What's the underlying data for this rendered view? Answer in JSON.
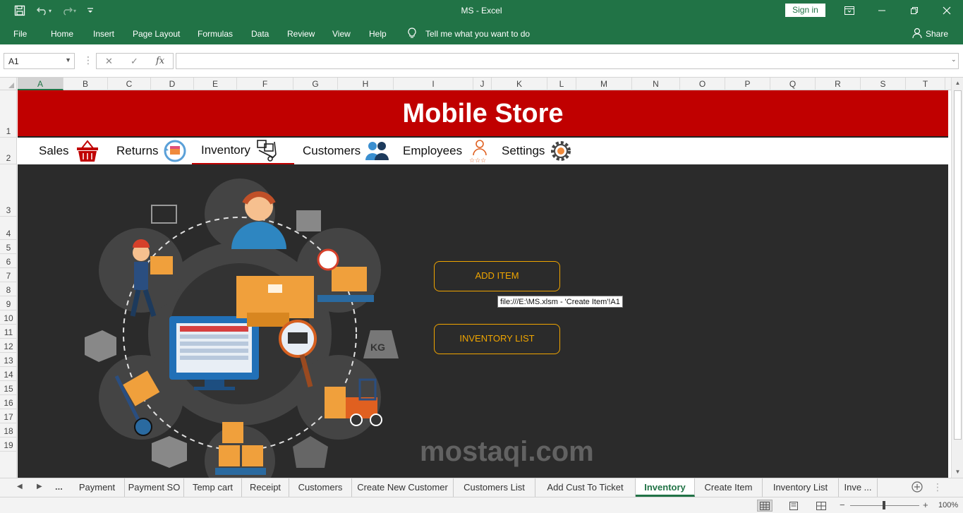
{
  "window": {
    "title": "MS  -  Excel",
    "sign_in": "Sign in"
  },
  "ribbon": {
    "tabs": [
      "File",
      "Home",
      "Insert",
      "Page Layout",
      "Formulas",
      "Data",
      "Review",
      "View",
      "Help"
    ],
    "tell_me": "Tell me what you want to do",
    "share": "Share"
  },
  "formula_bar": {
    "name_box": "A1",
    "fx_label": "fx",
    "formula": ""
  },
  "grid": {
    "columns": [
      "A",
      "B",
      "C",
      "D",
      "E",
      "F",
      "G",
      "H",
      "I",
      "J",
      "K",
      "L",
      "M",
      "N",
      "O",
      "P",
      "Q",
      "R",
      "S",
      "T"
    ],
    "selected_column": "A",
    "rows": [
      "1",
      "2",
      "3",
      "4",
      "5",
      "6",
      "7",
      "8",
      "9",
      "10",
      "11",
      "12",
      "13",
      "14",
      "15",
      "16",
      "17",
      "18",
      "19"
    ]
  },
  "sheet": {
    "banner_title": "Mobile Store",
    "nav": [
      {
        "label": "Sales",
        "icon": "basket-icon"
      },
      {
        "label": "Returns",
        "icon": "return-box-icon"
      },
      {
        "label": "Inventory",
        "icon": "hand-truck-icon",
        "active": true
      },
      {
        "label": "Customers",
        "icon": "people-icon"
      },
      {
        "label": "Employees",
        "icon": "employee-rating-icon"
      },
      {
        "label": "Settings",
        "icon": "gear-icon"
      }
    ],
    "buttons": {
      "add_item": "ADD ITEM",
      "inventory_list": "INVENTORY LIST"
    },
    "hyperlink_tooltip": "file:///E:\\MS.xlsm - 'Create Item'!A1",
    "watermark": "mostaqi.com",
    "colors": {
      "banner": "#c00000",
      "background": "#2b2b2b",
      "button_accent": "#f0a500",
      "excel_green": "#217346"
    }
  },
  "sheet_tabs": {
    "tabs": [
      "Payment",
      "Payment SO",
      "Temp cart",
      "Receipt",
      "Customers",
      "Create New Customer",
      "Customers List",
      "Add Cust To Ticket",
      "Inventory",
      "Create Item",
      "Inventory List",
      "Inve ..."
    ],
    "active": "Inventory",
    "more": "..."
  },
  "status_bar": {
    "zoom": "100%"
  }
}
